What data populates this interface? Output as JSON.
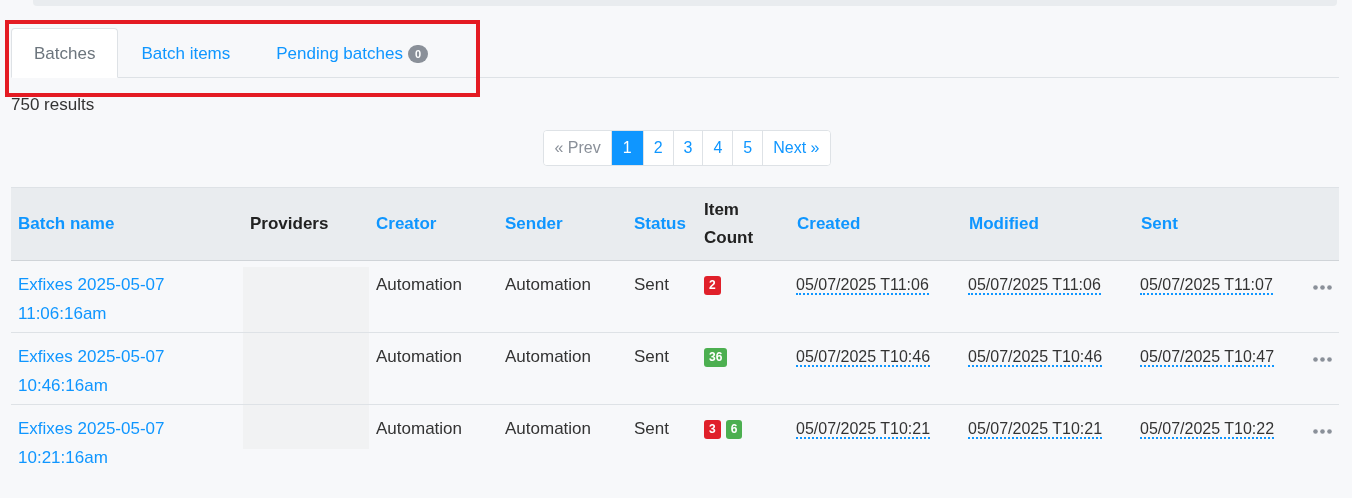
{
  "tabs": [
    {
      "label": "Batches",
      "selected": true
    },
    {
      "label": "Batch items",
      "selected": false
    },
    {
      "label": "Pending batches",
      "selected": false,
      "count": "0"
    }
  ],
  "highlight": true,
  "results": "750 results",
  "pagination": [
    {
      "label": "« Prev",
      "selected": false,
      "disabled": true
    },
    {
      "label": "1",
      "selected": true,
      "disabled": false
    },
    {
      "label": "2",
      "selected": false,
      "disabled": false
    },
    {
      "label": "3",
      "selected": false,
      "disabled": false
    },
    {
      "label": "4",
      "selected": false,
      "disabled": false
    },
    {
      "label": "5",
      "selected": false,
      "disabled": false
    },
    {
      "label": "Next »",
      "selected": false,
      "disabled": false
    }
  ],
  "table": {
    "columns": [
      {
        "label": "Batch name",
        "sortable": true
      },
      {
        "label": "Providers",
        "sortable": false
      },
      {
        "label": "Creator",
        "sortable": true
      },
      {
        "label": "Sender",
        "sortable": true
      },
      {
        "label": "Status",
        "sortable": true
      },
      {
        "label": "Item Count",
        "sortable": false
      },
      {
        "label": "Created",
        "sortable": true
      },
      {
        "label": "Modified",
        "sortable": true
      },
      {
        "label": "Sent",
        "sortable": true
      }
    ],
    "rows": [
      {
        "name": "Exfixes 2025-05-07 11:06:16am",
        "creator": "Automation",
        "sender": "Automation",
        "status": "Sent",
        "counts": [
          {
            "value": "2",
            "color": "#e0202a"
          }
        ],
        "created": "05/07/2025 T11:06",
        "modified": "05/07/2025 T11:06",
        "sent": "05/07/2025 T11:07"
      },
      {
        "name": "Exfixes 2025-05-07 10:46:16am",
        "creator": "Automation",
        "sender": "Automation",
        "status": "Sent",
        "counts": [
          {
            "value": "36",
            "color": "#4caf50"
          }
        ],
        "created": "05/07/2025 T10:46",
        "modified": "05/07/2025 T10:46",
        "sent": "05/07/2025 T10:47"
      },
      {
        "name": "Exfixes 2025-05-07 10:21:16am",
        "creator": "Automation",
        "sender": "Automation",
        "status": "Sent",
        "counts": [
          {
            "value": "3",
            "color": "#e0202a"
          },
          {
            "value": "6",
            "color": "#4caf50"
          }
        ],
        "created": "05/07/2025 T10:21",
        "modified": "05/07/2025 T10:21",
        "sent": "05/07/2025 T10:22"
      }
    ]
  }
}
